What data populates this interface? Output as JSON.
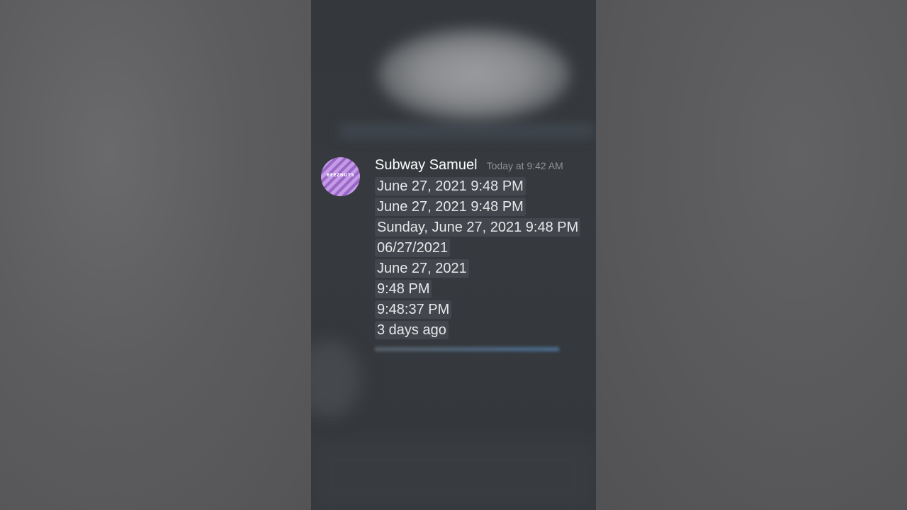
{
  "message": {
    "author": "Subway Samuel",
    "timestamp": "Today at 9:42 AM",
    "avatar_text": "BEEZNUTS",
    "lines": [
      "June 27, 2021 9:48 PM",
      "June 27, 2021 9:48 PM",
      "Sunday, June 27, 2021 9:48 PM",
      "06/27/2021",
      "June 27, 2021",
      "9:48 PM",
      "9:48:37 PM",
      "3 days ago"
    ]
  },
  "colors": {
    "background": "#5a5a5b",
    "chat_background": "#36393f",
    "username": "#ffffff",
    "timestamp": "#8e9297",
    "chip_background": "#43464c",
    "avatar_primary": "#c49be6"
  },
  "icons": {
    "avatar": "striped-avatar-icon"
  }
}
